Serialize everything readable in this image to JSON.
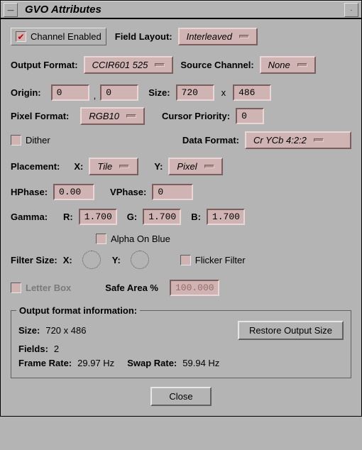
{
  "window": {
    "title": "GVO Attributes",
    "menu_glyph": "—",
    "min_glyph": "·"
  },
  "channel_enabled": {
    "label": "Channel Enabled",
    "checked": true
  },
  "field_layout": {
    "label": "Field Layout:",
    "value": "Interleaved"
  },
  "output_format": {
    "label": "Output Format:",
    "value": "CCIR601 525"
  },
  "source_channel": {
    "label": "Source Channel:",
    "value": "None"
  },
  "origin": {
    "label": "Origin:",
    "x": "0",
    "y": "0",
    "comma": ","
  },
  "size": {
    "label": "Size:",
    "w": "720",
    "x_glyph": "x",
    "h": "486"
  },
  "pixel_format": {
    "label": "Pixel Format:",
    "value": "RGB10"
  },
  "cursor_priority": {
    "label": "Cursor Priority:",
    "value": "0"
  },
  "dither": {
    "label": "Dither",
    "checked": false
  },
  "data_format": {
    "label": "Data Format:",
    "value": "Cr YCb   4:2:2"
  },
  "placement": {
    "label": "Placement:",
    "x_label": "X:",
    "x_value": "Tile",
    "y_label": "Y:",
    "y_value": "Pixel"
  },
  "hphase": {
    "label": "HPhase:",
    "value": "0.00"
  },
  "vphase": {
    "label": "VPhase:",
    "value": "0"
  },
  "gamma": {
    "label": "Gamma:",
    "r_label": "R:",
    "r": "1.700",
    "g_label": "G:",
    "g": "1.700",
    "b_label": "B:",
    "b": "1.700"
  },
  "alpha_on_blue": {
    "label": "Alpha On Blue",
    "checked": false
  },
  "filter_size": {
    "label": "Filter Size:",
    "x_label": "X:",
    "y_label": "Y:"
  },
  "flicker_filter": {
    "label": "Flicker Filter",
    "checked": false
  },
  "letter_box": {
    "label": "Letter Box",
    "checked": false
  },
  "safe_area": {
    "label": "Safe Area %",
    "value": "100.000"
  },
  "output_info": {
    "legend": "Output format information:",
    "size_label": "Size:",
    "size_value": "720 x 486",
    "fields_label": "Fields:",
    "fields_value": "2",
    "frame_label": "Frame Rate:",
    "frame_value": "29.97 Hz",
    "swap_label": "Swap Rate:",
    "swap_value": "59.94 Hz",
    "restore_button": "Restore Output Size"
  },
  "close_button": "Close"
}
